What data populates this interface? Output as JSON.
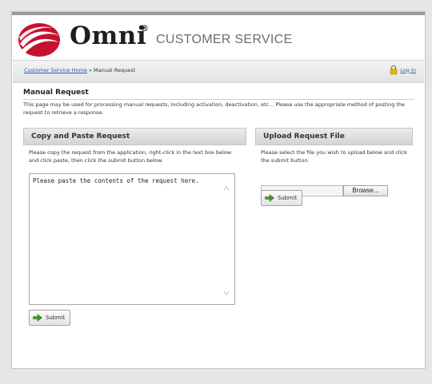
{
  "header": {
    "brand": "Omni",
    "registered_mark": "®",
    "service_title": "CUSTOMER SERVICE"
  },
  "breadcrumb": {
    "home_link": "Customer Service Home",
    "separator": " » ",
    "current": "Manual Request"
  },
  "login": {
    "label": "Log In"
  },
  "page": {
    "title": "Manual Request",
    "intro": "This page may be used for processing manual requests, including activation, deactivation, etc... Please use the appropriate method of posting the request to retrieve a response."
  },
  "copy_panel": {
    "heading": "Copy and Paste Request",
    "instructions": "Please copy the request from the application, right-click in the text box below and click paste, then click the submit button below.",
    "textarea_value": "Please paste the contents of the request here.",
    "submit_label": "Submit"
  },
  "upload_panel": {
    "heading": "Upload Request File",
    "instructions": "Please select the file you wish to upload below and click the submit button.",
    "browse_label": "Browse...",
    "submit_label": "Submit"
  },
  "colors": {
    "logo_red": "#c8102e",
    "link_blue": "#2a5db0",
    "submit_arrow_green": "#3f9a2a",
    "lock_yellow": "#e8b800"
  },
  "icons": {
    "logo": "omni-swoosh-logo-icon",
    "lock": "lock-icon",
    "submit": "green-arrow-icon"
  }
}
